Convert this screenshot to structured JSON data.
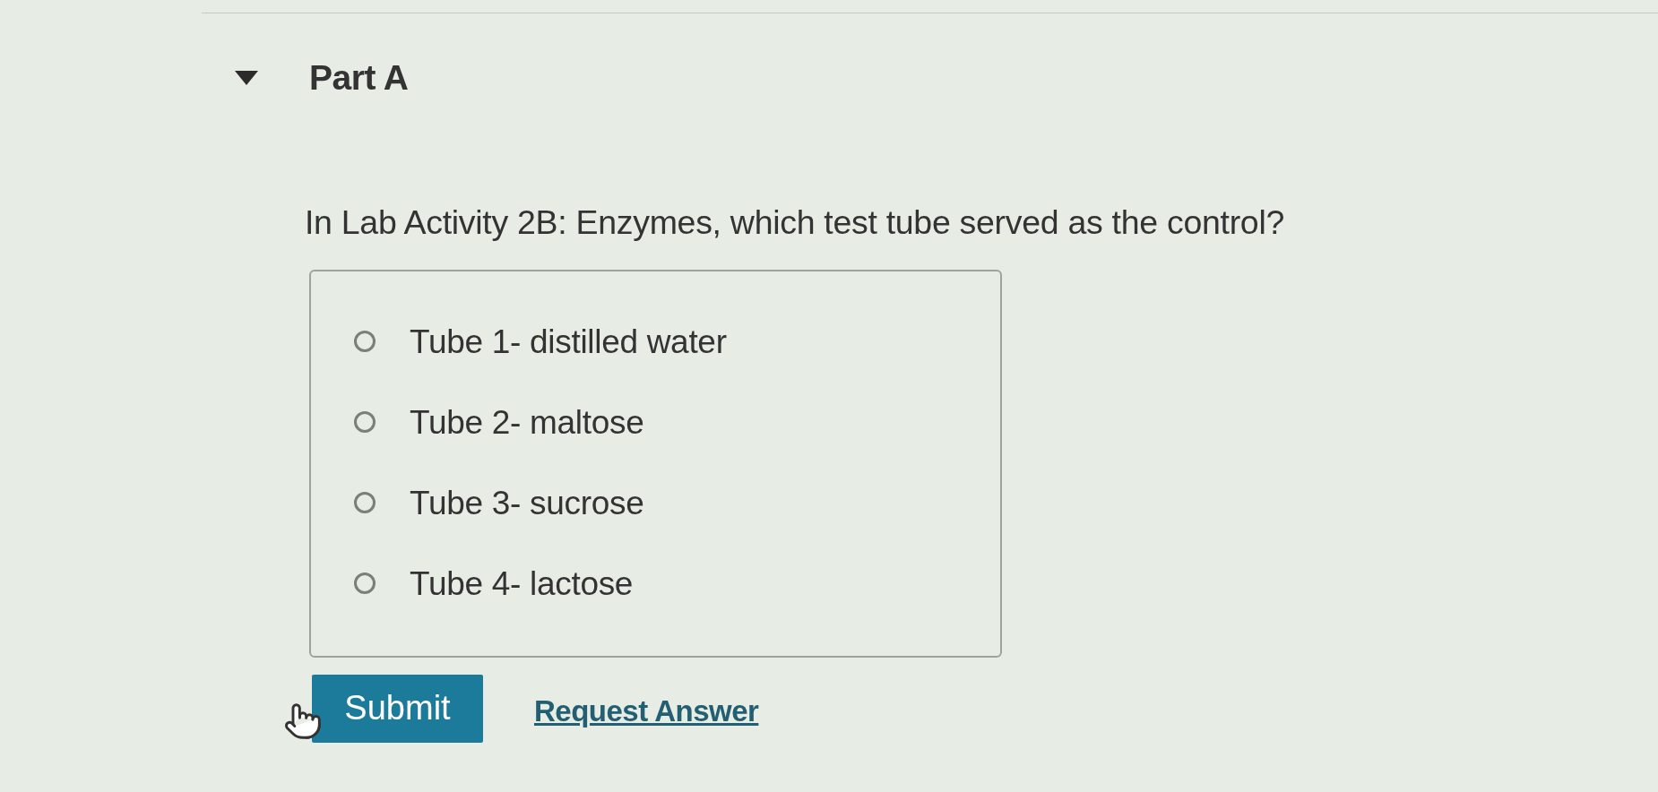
{
  "part": {
    "title": "Part A",
    "expanded": true
  },
  "question": {
    "text": "In Lab Activity 2B: Enzymes, which test tube served as the control?"
  },
  "options": [
    {
      "label": "Tube 1- distilled water",
      "selected": false
    },
    {
      "label": "Tube 2- maltose",
      "selected": false
    },
    {
      "label": "Tube 3- sucrose",
      "selected": false
    },
    {
      "label": "Tube 4- lactose",
      "selected": false
    }
  ],
  "actions": {
    "submit": "Submit",
    "request_answer": "Request Answer"
  }
}
